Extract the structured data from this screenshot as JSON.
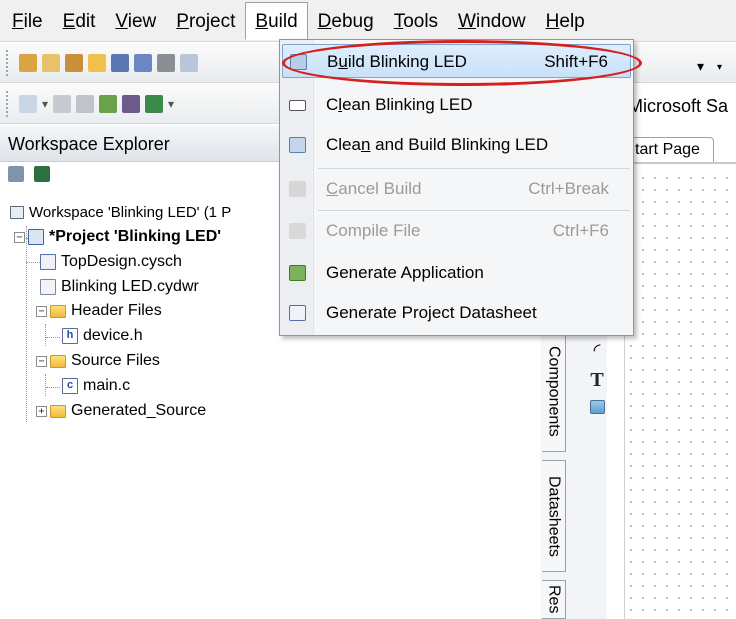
{
  "menubar": {
    "items": [
      {
        "pre": "",
        "acc": "F",
        "post": "ile"
      },
      {
        "pre": "",
        "acc": "E",
        "post": "dit"
      },
      {
        "pre": "",
        "acc": "V",
        "post": "iew"
      },
      {
        "pre": "",
        "acc": "P",
        "post": "roject"
      },
      {
        "pre": "",
        "acc": "B",
        "post": "uild"
      },
      {
        "pre": "",
        "acc": "D",
        "post": "ebug"
      },
      {
        "pre": "",
        "acc": "T",
        "post": "ools"
      },
      {
        "pre": "",
        "acc": "W",
        "post": "indow"
      },
      {
        "pre": "",
        "acc": "H",
        "post": "elp"
      }
    ]
  },
  "workspace": {
    "header": "Workspace Explorer",
    "root": "Workspace 'Blinking LED' (1 P",
    "project": "*Project  'Blinking LED'",
    "items": {
      "top_design": "TopDesign.cysch",
      "cydwr": "Blinking LED.cydwr",
      "header_files": "Header Files",
      "device_h": "device.h",
      "source_files": "Source Files",
      "main_c": "main.c",
      "generated_source": "Generated_Source"
    },
    "file_badges": {
      "h": "h",
      "c": "c"
    }
  },
  "build_menu": {
    "items": [
      {
        "label_pre": "B",
        "label_acc": "u",
        "label_post": "ild Blinking LED",
        "shortcut": "Shift+F6"
      },
      {
        "label_pre": "C",
        "label_acc": "l",
        "label_post": "ean Blinking LED",
        "shortcut": ""
      },
      {
        "label_pre": "Clea",
        "label_acc": "n",
        "label_post": " and Build Blinking LED",
        "shortcut": ""
      },
      {
        "label_pre": "",
        "label_acc": "C",
        "label_post": "ancel Build",
        "shortcut": "Ctrl+Break"
      },
      {
        "label_pre": "Compile File",
        "label_acc": "",
        "label_post": "",
        "shortcut": "Ctrl+F6"
      },
      {
        "label_pre": "Generate Application",
        "label_acc": "",
        "label_post": "",
        "shortcut": ""
      },
      {
        "label_pre": "Generate Project Datasheet",
        "label_acc": "",
        "label_post": "",
        "shortcut": ""
      }
    ]
  },
  "editor": {
    "toolbar_text": "Microsoft Sa",
    "tab_label": "tart Page"
  },
  "side_tabs": {
    "components": "Components",
    "datasheets": "Datasheets",
    "resources": "Res"
  },
  "palette": {
    "text_tool": "T"
  },
  "colors": {
    "menu_highlight": "#c8e1f9",
    "annotation_ring": "#d62020",
    "folder": "#f0b93a"
  }
}
